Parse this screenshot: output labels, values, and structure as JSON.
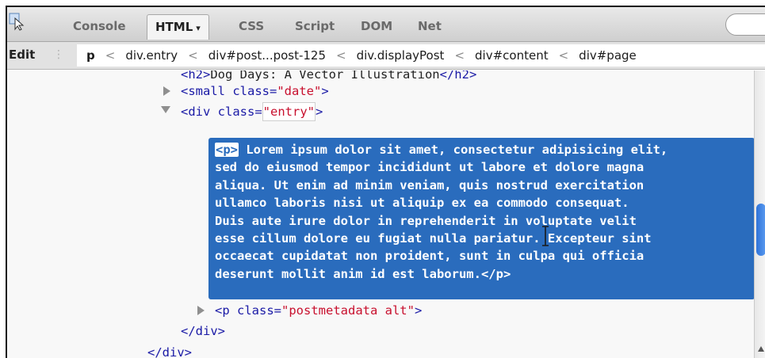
{
  "toolbar": {
    "tabs": [
      {
        "label": "Console",
        "active": false
      },
      {
        "label": "HTML",
        "active": true,
        "dropdown": "▾"
      },
      {
        "label": "CSS",
        "active": false
      },
      {
        "label": "Script",
        "active": false
      },
      {
        "label": "DOM",
        "active": false
      },
      {
        "label": "Net",
        "active": false
      }
    ],
    "inspect_icon": "inspect-arrow-icon",
    "search_placeholder": ""
  },
  "breadcrumb": {
    "edit_label": "Edit",
    "separator": "<",
    "items": [
      "p",
      "div.entry",
      "div#post...post-125",
      "div.displayPost",
      "div#content",
      "div#page"
    ]
  },
  "tree": {
    "h2_open": "<h2>",
    "h2_text": "Dog Days: A Vector Illustration",
    "h2_close": "</h2>",
    "small_open": "<small ",
    "small_attr": "class=",
    "small_val": "\"date\"",
    "small_end": ">",
    "div_open": "<div ",
    "div_attr": "class=",
    "div_val": "\"entry\"",
    "div_end": ">",
    "selected_tag_open": "<p>",
    "selected_lines": [
      "Lorem ipsum dolor sit amet, consectetur adipisicing elit,",
      "sed do eiusmod tempor incididunt ut labore et dolore magna",
      "aliqua. Ut enim ad minim veniam, quis nostrud exercitation",
      "ullamco laboris nisi ut aliquip ex ea commodo consequat.",
      "Duis aute irure dolor in reprehenderit in voluptate velit",
      "esse cillum dolore eu fugiat nulla pariatur. Excepteur sint",
      "occaecat cupidatat non proident, sunt in culpa qui officia",
      "deserunt mollit anim id est laborum."
    ],
    "selected_tag_close": "</p>",
    "p2_open": "<p ",
    "p2_attr": "class=",
    "p2_val": "\"postmetadata alt\"",
    "p2_end": ">",
    "div_close": "</div>",
    "outer_div_close": "</div>"
  },
  "colors": {
    "selection": "#2a6cbd",
    "scroll_thumb": "#2f73d8",
    "attr_value": "#c8102e",
    "tag": "#1a1aa6"
  },
  "scroll": {
    "position_fraction": 0.5
  }
}
